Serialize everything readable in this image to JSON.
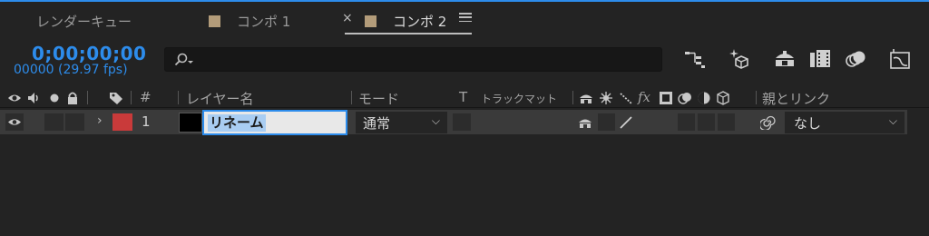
{
  "colors": {
    "accent": "#2d8ceb",
    "label_red": "#c93a3a",
    "comp_swatch": "#b39c7a"
  },
  "tabs": [
    {
      "label": "レンダーキュー"
    },
    {
      "label": "コンポ 1"
    },
    {
      "label": "コンポ 2",
      "active": true
    }
  ],
  "tab_close": "×",
  "timecode": "0;00;00;00",
  "framecount": "00000 (29.97 fps)",
  "search": {
    "value": "",
    "placeholder": ""
  },
  "columns": {
    "number": "#",
    "layer_name": "レイヤー名",
    "mode": "モード",
    "t": "T",
    "track_matte": "トラックマット",
    "fx": "fx",
    "parent": "親とリンク"
  },
  "layer": {
    "number": "1",
    "name": "リネーム",
    "mode": "通常",
    "parent": "なし"
  }
}
